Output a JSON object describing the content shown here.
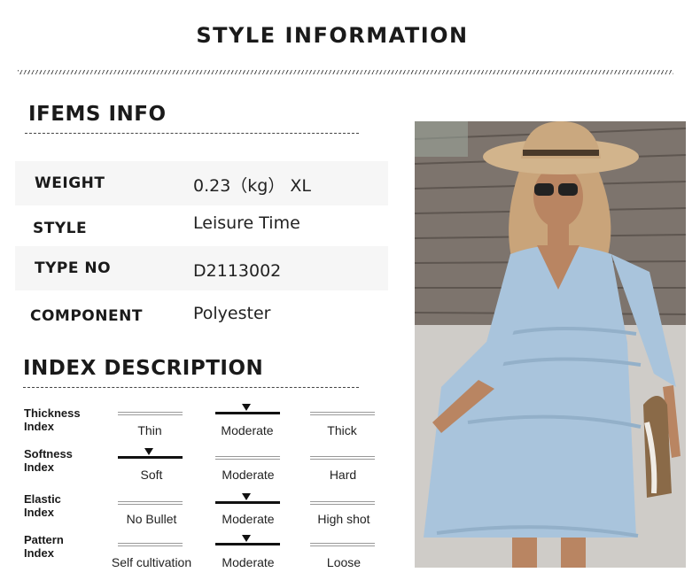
{
  "page_title": "STYLE INFORMATION",
  "items_info": {
    "heading": "IFEMS INFO",
    "rows": [
      {
        "label": "WEIGHT",
        "value": "0.23（kg） XL"
      },
      {
        "label": "STYLE",
        "value": "Leisure Time"
      },
      {
        "label": "TYPE NO",
        "value": "D2113002"
      },
      {
        "label": "COMPONENT",
        "value": "Polyester"
      }
    ]
  },
  "index_description": {
    "heading": "INDEX DESCRIPTION",
    "indices": [
      {
        "name_line1": "Thickness",
        "name_line2": "Index",
        "options": [
          "Thin",
          "Moderate",
          "Thick"
        ],
        "selected": 1
      },
      {
        "name_line1": "Softness",
        "name_line2": "Index",
        "options": [
          "Soft",
          "Moderate",
          "Hard"
        ],
        "selected": 0
      },
      {
        "name_line1": "Elastic",
        "name_line2": "Index",
        "options": [
          "No Bullet",
          "Moderate",
          "High shot"
        ],
        "selected": 1
      },
      {
        "name_line1": "Pattern",
        "name_line2": "Index",
        "options": [
          "Self cultivation",
          "Moderate",
          "Loose"
        ],
        "selected": 1
      }
    ]
  }
}
